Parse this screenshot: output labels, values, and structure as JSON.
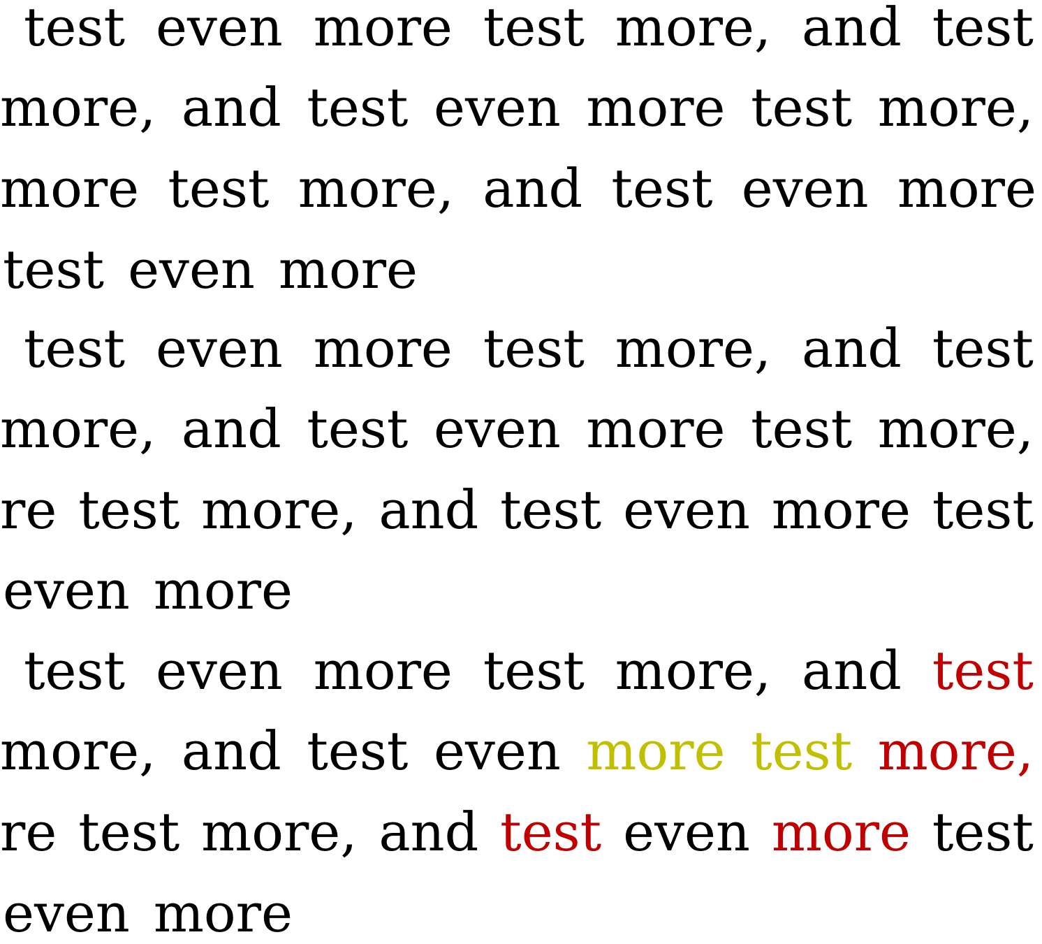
{
  "colors": {
    "text": "#000000",
    "red": "#c00000",
    "yellow": "#c0c000"
  },
  "lines": [
    {
      "align": "justify",
      "words": [
        {
          "t": "test"
        },
        {
          "t": "even"
        },
        {
          "t": "more"
        },
        {
          "t": "test"
        },
        {
          "t": "more,"
        },
        {
          "t": "and"
        },
        {
          "t": "test"
        }
      ]
    },
    {
      "align": "justify",
      "words": [
        {
          "t": "more,"
        },
        {
          "t": "and"
        },
        {
          "t": "test"
        },
        {
          "t": "even"
        },
        {
          "t": "more"
        },
        {
          "t": "test"
        },
        {
          "t": "more,"
        }
      ]
    },
    {
      "align": "justify",
      "words": [
        {
          "t": "more"
        },
        {
          "t": "test"
        },
        {
          "t": "more,"
        },
        {
          "t": "and"
        },
        {
          "t": "test"
        },
        {
          "t": "even"
        },
        {
          "t": "more"
        }
      ]
    },
    {
      "align": "left",
      "words": [
        {
          "t": "test"
        },
        {
          "t": "even"
        },
        {
          "t": "more"
        }
      ]
    },
    {
      "align": "justify",
      "words": [
        {
          "t": "test"
        },
        {
          "t": "even"
        },
        {
          "t": "more"
        },
        {
          "t": "test"
        },
        {
          "t": "more,"
        },
        {
          "t": "and"
        },
        {
          "t": "test"
        }
      ]
    },
    {
      "align": "justify",
      "words": [
        {
          "t": "more,"
        },
        {
          "t": "and"
        },
        {
          "t": "test"
        },
        {
          "t": "even"
        },
        {
          "t": "more"
        },
        {
          "t": "test"
        },
        {
          "t": "more,"
        }
      ]
    },
    {
      "align": "justify",
      "words": [
        {
          "t": "re"
        },
        {
          "t": "test"
        },
        {
          "t": "more,"
        },
        {
          "t": "and"
        },
        {
          "t": "test"
        },
        {
          "t": "even"
        },
        {
          "t": "more"
        },
        {
          "t": "test"
        }
      ]
    },
    {
      "align": "left",
      "words": [
        {
          "t": "even"
        },
        {
          "t": "more"
        }
      ]
    },
    {
      "align": "justify",
      "words": [
        {
          "t": "test"
        },
        {
          "t": "even"
        },
        {
          "t": "more"
        },
        {
          "t": "test"
        },
        {
          "t": "more,"
        },
        {
          "t": "and"
        },
        {
          "t": "test",
          "c": "red"
        }
      ]
    },
    {
      "align": "justify",
      "words": [
        {
          "t": "more,"
        },
        {
          "t": "and"
        },
        {
          "t": "test"
        },
        {
          "t": "even"
        },
        {
          "t": "more",
          "c": "yellow"
        },
        {
          "t": "test",
          "c": "yellow"
        },
        {
          "t": "more,",
          "c": "red"
        }
      ]
    },
    {
      "align": "justify",
      "words": [
        {
          "t": "re"
        },
        {
          "t": "test"
        },
        {
          "t": "more,"
        },
        {
          "t": "and"
        },
        {
          "t": "test",
          "c": "red"
        },
        {
          "t": "even"
        },
        {
          "t": "more",
          "c": "red"
        },
        {
          "t": "test"
        }
      ]
    },
    {
      "align": "left",
      "words": [
        {
          "t": "even"
        },
        {
          "t": "more"
        }
      ]
    }
  ]
}
